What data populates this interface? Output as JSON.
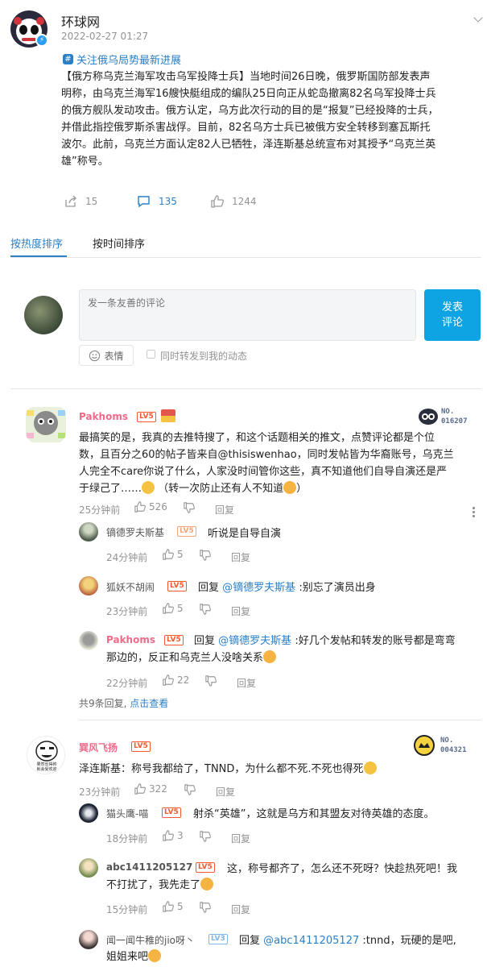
{
  "post": {
    "author": "环球网",
    "time": "2022-02-27 01:27",
    "topic": "关注俄乌局势最新进展",
    "body_line1": "【俄方称乌克兰海军攻击乌军投降士兵】当地时间26日晚，俄罗斯国防部发表声",
    "body_line2": "明称，由乌克兰海军16艘快艇组成的编队25日向正从蛇岛撤离82名乌军投降士兵",
    "body_line3": "的俄方舰队发动攻击。俄方认定，乌方此次行动的目的是“报复”已经投降的士兵，",
    "body_line4": "并借此指控俄罗斯杀害战俘。目前，82名乌方士兵已被俄方安全转移到塞瓦斯托",
    "body_line5": "波尔。此前，乌克兰方面认定82人已牺牲，泽连斯基总统宣布对其授予“乌克兰英",
    "body_line6": "雄”称号。",
    "shares": "15",
    "comments": "135",
    "likes": "1244"
  },
  "tabs": {
    "hot": "按热度排序",
    "time": "按时间排序"
  },
  "composer": {
    "placeholder": "发一条友善的评论",
    "submit_line1": "发表",
    "submit_line2": "评论",
    "emoji_label": "表情",
    "repost_label": "同时转发到我的动态"
  },
  "comments": [
    {
      "user": "Pakhoms",
      "level": "LV5",
      "medal_no": "NO.",
      "medal_num": "016207",
      "line1": "最搞笑的是，我真的去推特搜了，和这个话题相关的推文，点赞评论都是个位",
      "line2": "数，且百分之60的帖子皆来自@thisiswenhao，同时发帖皆为华裔账号，乌克兰",
      "line3": "人完全不care你说了什么，人家没时间管你这些，真不知道他们自导自演还是严",
      "line4": "于绿己了……",
      "line4b": "（转一次防止还有人不知道",
      "line4c": "）",
      "time": "25分钟前",
      "likes": "526",
      "reply_label": "回复",
      "replies": [
        {
          "user": "镝德罗夫斯基",
          "level": "LV5",
          "text": "听说是自导自演",
          "time": "24分钟前",
          "likes": "5",
          "reply_label": "回复"
        },
        {
          "user": "狐妖不胡闹",
          "level": "LV5",
          "prefix": "回复",
          "mention": "@镝德罗夫斯基",
          "text": ":别忘了演员出身",
          "time": "23分钟前",
          "likes": "5",
          "reply_label": "回复"
        },
        {
          "user": "Pakhoms",
          "level": "LV5",
          "prefix": "回复",
          "mention": "@镝德罗夫斯基",
          "text": ":好几个发帖和转发的账号都是弯弯",
          "text2": "那边的，反正和乌克兰人没啥关系",
          "time": "22分钟前",
          "likes": "22",
          "reply_label": "回复"
        }
      ],
      "more_count": "共9条回复,",
      "more_link": "点击查看"
    },
    {
      "user": "巽风飞扬",
      "level": "LV5",
      "medal_no": "NO.",
      "medal_num": "004321",
      "avatar_text": "果然长得帅\n就会受欢迎",
      "line1": "泽连斯基：称号我都给了，TNND，为什么都不死.不死也得死",
      "time": "23分钟前",
      "likes": "322",
      "reply_label": "回复",
      "replies": [
        {
          "user": "猫头鹰-喵",
          "level": "LV5",
          "text": "射杀“英雄”，这就是乌方和其盟友对待英雄的态度。",
          "time": "18分钟前",
          "likes": "3",
          "reply_label": "回复"
        },
        {
          "user": "abc1411205127",
          "level": "LV5",
          "text": "这，称号都齐了，怎么还不死呀？快趁热死吧！我",
          "text2": "不打扰了，我先走了",
          "time": "15分钟前",
          "likes": "5",
          "reply_label": "回复"
        },
        {
          "user": "闻一闻牛稚的jio呀丶",
          "level": "LV3",
          "prefix": "回复",
          "mention": "@abc1411205127",
          "text": ":tnnd，玩硬的是吧,",
          "text2": "姐姐来吧"
        }
      ]
    }
  ],
  "colors": {
    "accent": "#2a7fc5",
    "submit": "#0ea3e2",
    "username_vip": "#f06a8a",
    "level": "#f25b2e"
  }
}
